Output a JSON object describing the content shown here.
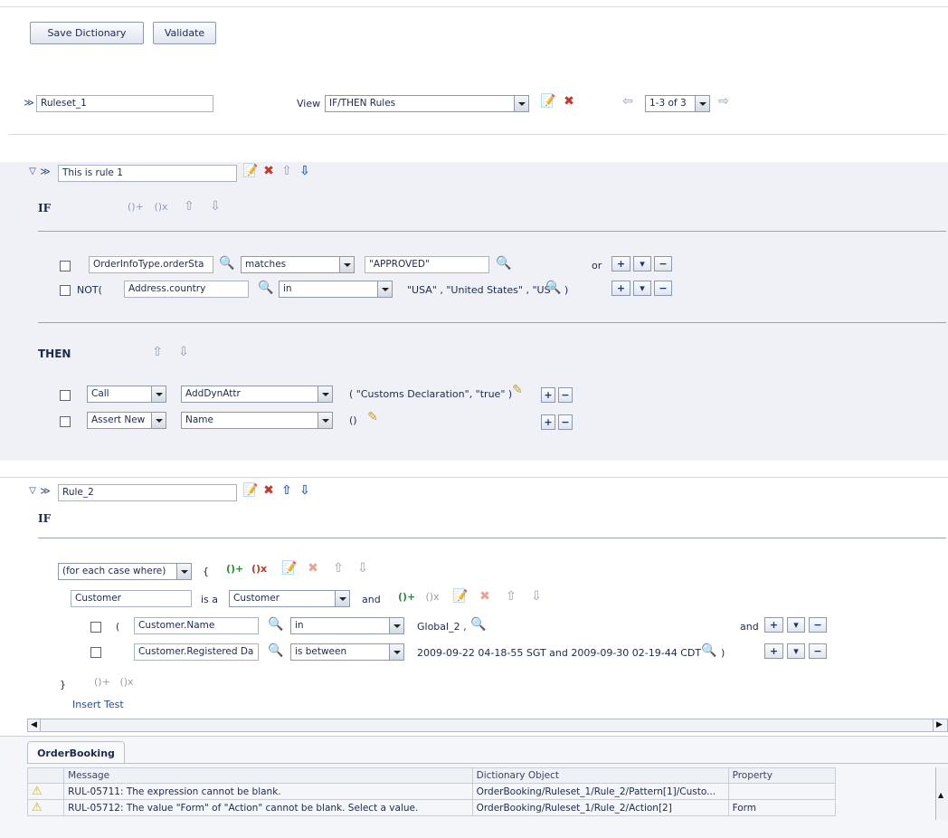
{
  "toolbar": {
    "save_label": "Save Dictionary",
    "validate_label": "Validate"
  },
  "ruleset": {
    "name_value": "Ruleset_1",
    "view_label": "View",
    "view_value": "IF/THEN Rules",
    "pager_value": "1-3 of 3"
  },
  "rule1": {
    "name_value": "This is rule 1",
    "if_label": "IF",
    "tests": [
      {
        "left": "OrderInfoType.orderSta",
        "op": "matches",
        "right": "\"APPROVED\"",
        "conj": "or"
      },
      {
        "not_label": "NOT(",
        "left": "Address.country",
        "op": "in",
        "right": "\"USA\" , \"United States\" , \"US\"",
        "close": ")"
      }
    ],
    "then_label": "THEN",
    "actions": [
      {
        "type": "Call",
        "target": "AddDynAttr",
        "args": "( \"Customs Declaration\", \"true\" )"
      },
      {
        "type": "Assert New",
        "target": "Name",
        "args": "()"
      }
    ]
  },
  "rule2": {
    "name_value": "Rule_2",
    "if_label": "IF",
    "pattern_value": "(for each case where)",
    "open_brace": "{",
    "fact_alias": "Customer",
    "is_a_label": "is a",
    "fact_type": "Customer",
    "and_label": "and",
    "tests": [
      {
        "open": "(",
        "left": "Customer.Name",
        "op": "in",
        "right": "Global_2 ,",
        "conj": "and"
      },
      {
        "left": "Customer.Registered Da",
        "op": "is between",
        "right": "2009-09-22 04-18-55 SGT and 2009-09-30 02-19-44 CDT",
        "close": ")"
      }
    ],
    "close_brace": "}",
    "insert_test": "Insert Test"
  },
  "messages": {
    "tab_label": "OrderBooking",
    "columns": [
      "Message",
      "Dictionary Object",
      "Property"
    ],
    "rows": [
      {
        "message": "RUL-05711: The expression cannot be blank.",
        "object": "OrderBooking/Ruleset_1/Rule_2/Pattern[1]/Custo...",
        "property": ""
      },
      {
        "message": "RUL-05712: The value \"Form\" of \"Action\" cannot be blank. Select a value.",
        "object": "OrderBooking/Ruleset_1/Rule_2/Action[2]",
        "property": "Form"
      }
    ]
  },
  "colors": {
    "panel_bg": "#eff1f7",
    "warning": "#e0b000",
    "delete_red": "#c0392b",
    "nav_blue": "#2b62c4"
  }
}
